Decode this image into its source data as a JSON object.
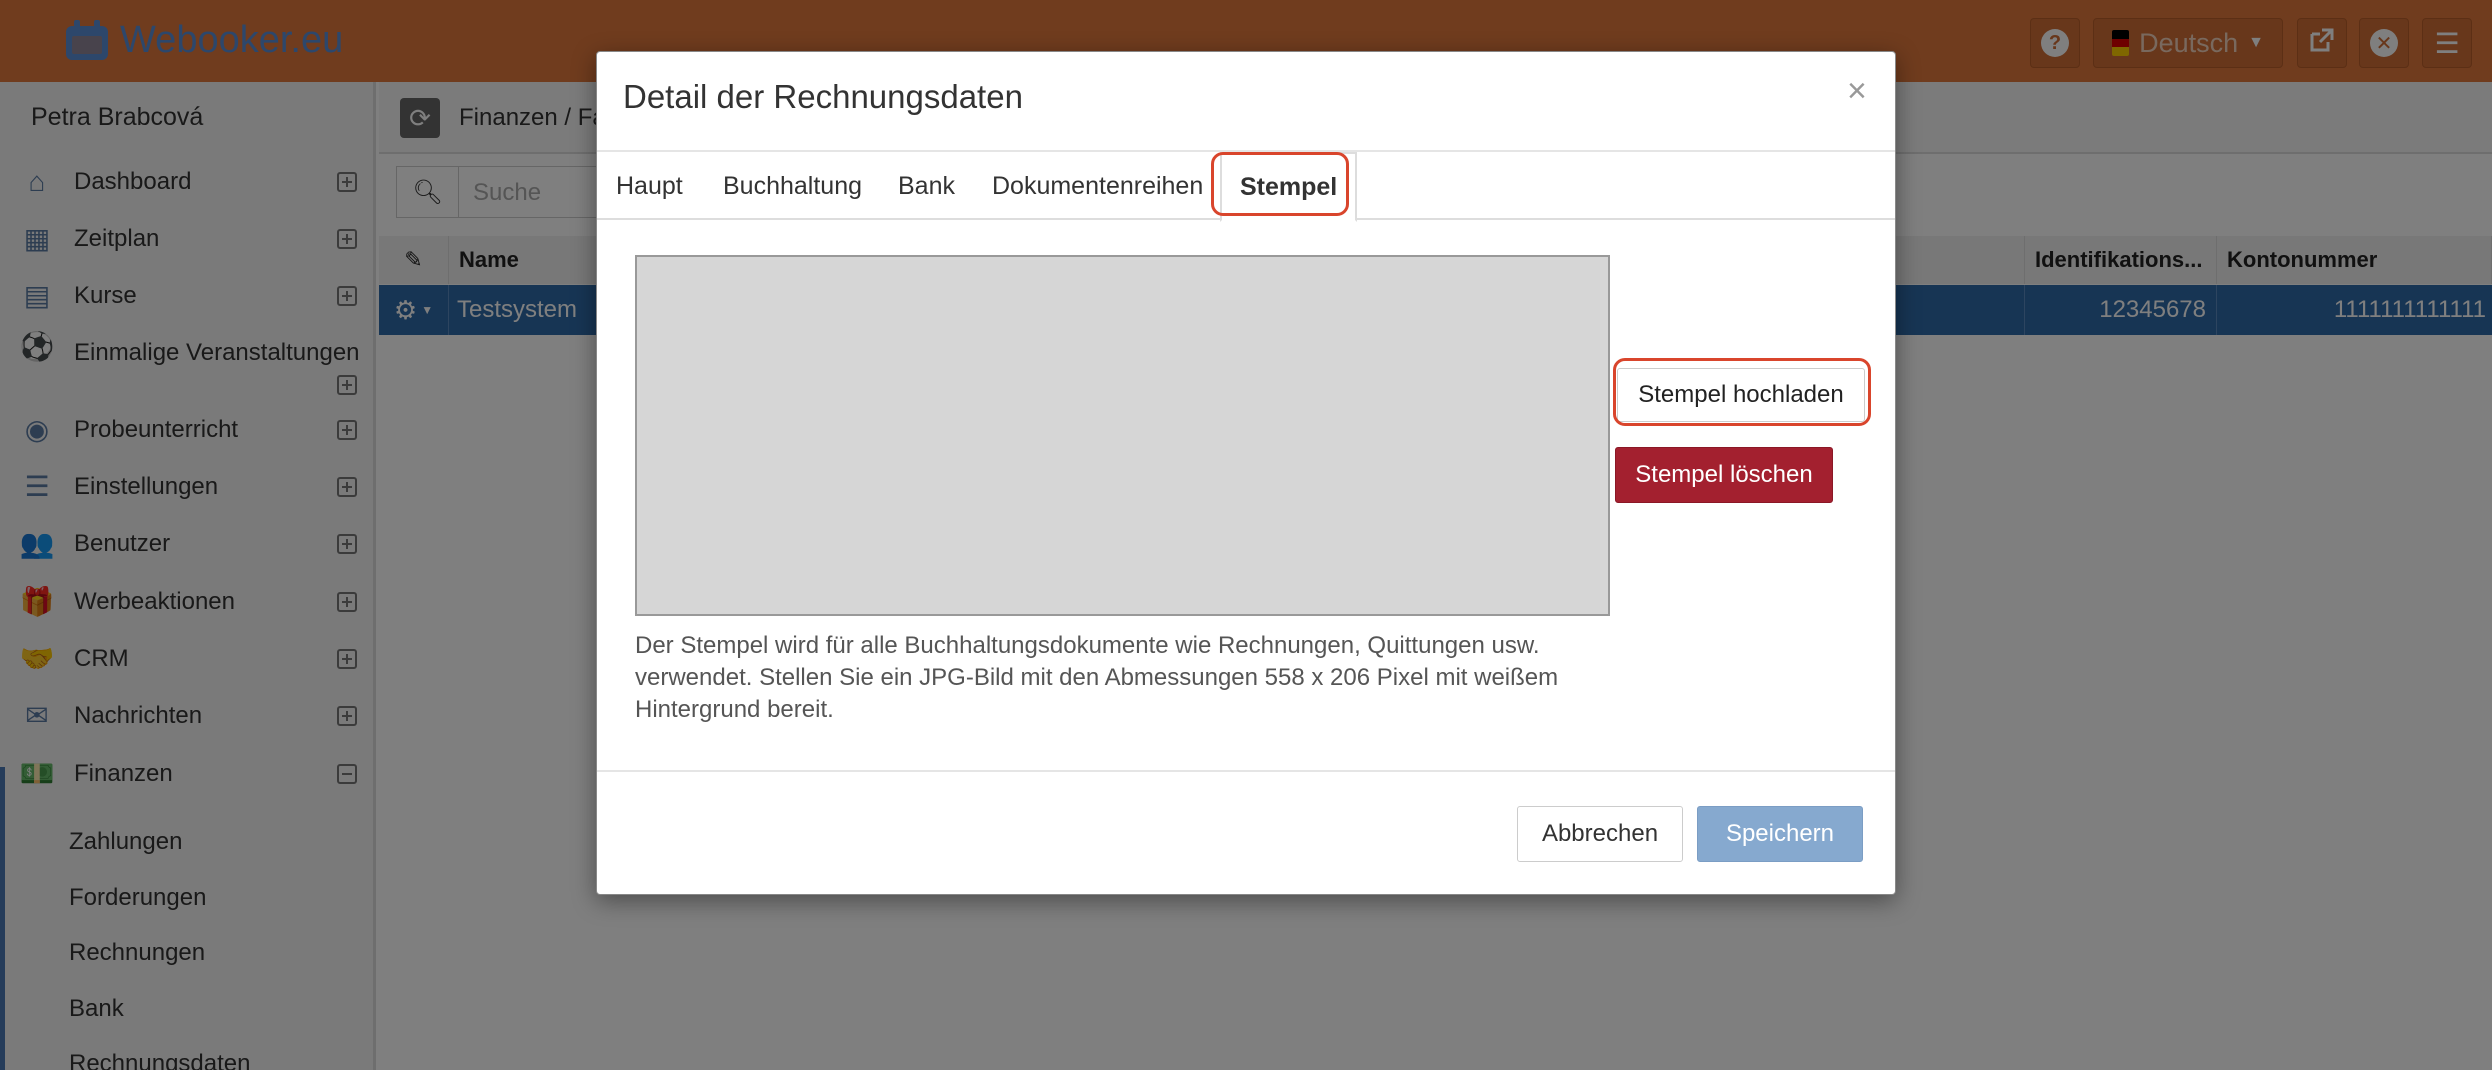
{
  "app": {
    "logo_text": "Webooker.eu",
    "language": "Deutsch",
    "user_name": "Petra Brabcová",
    "breadcrumb": "Finanzen / Fa"
  },
  "sidebar": {
    "items": [
      {
        "label": "Dashboard",
        "icon": "home-icon"
      },
      {
        "label": "Zeitplan",
        "icon": "calendar-icon"
      },
      {
        "label": "Kurse",
        "icon": "book-icon"
      },
      {
        "label": "Einmalige Veranstaltungen",
        "icon": "ball-icon"
      },
      {
        "label": "Probeunterricht",
        "icon": "eye-icon"
      },
      {
        "label": "Einstellungen",
        "icon": "settings-icon"
      },
      {
        "label": "Benutzer",
        "icon": "users-icon"
      },
      {
        "label": "Werbeaktionen",
        "icon": "gift-icon"
      },
      {
        "label": "CRM",
        "icon": "handshake-icon"
      },
      {
        "label": "Nachrichten",
        "icon": "envelope-icon"
      },
      {
        "label": "Finanzen",
        "icon": "money-icon"
      }
    ],
    "sub_items": [
      "Zahlungen",
      "Forderungen",
      "Rechnungen",
      "Bank",
      "Rechnungsdaten"
    ]
  },
  "search": {
    "placeholder": "Suche"
  },
  "table": {
    "headers": {
      "name": "Name",
      "id": "Identifikations...",
      "account": "Kontonummer"
    },
    "row": {
      "name": "Testsystem",
      "id": "12345678",
      "account": "1111111111111"
    }
  },
  "modal": {
    "title": "Detail der Rechnungsdaten",
    "close": "×",
    "tabs": [
      "Haupt",
      "Buchhaltung",
      "Bank",
      "Dokumentenreihen",
      "Stempel"
    ],
    "active_tab": "Stempel",
    "upload_label": "Stempel hochladen",
    "delete_label": "Stempel löschen",
    "help_text": "Der Stempel wird für alle Buchhaltungsdokumente wie Rechnungen, Quittungen usw. verwendet. Stellen Sie ein JPG-Bild mit den Abmessungen 558 x 206 Pixel mit weißem Hintergrund bereit.",
    "cancel_label": "Abbrechen",
    "save_label": "Speichern"
  },
  "colors": {
    "topbar": "#e0793c",
    "accent": "#2f6aa8",
    "danger": "#a3202f",
    "highlight": "#d9452c"
  }
}
